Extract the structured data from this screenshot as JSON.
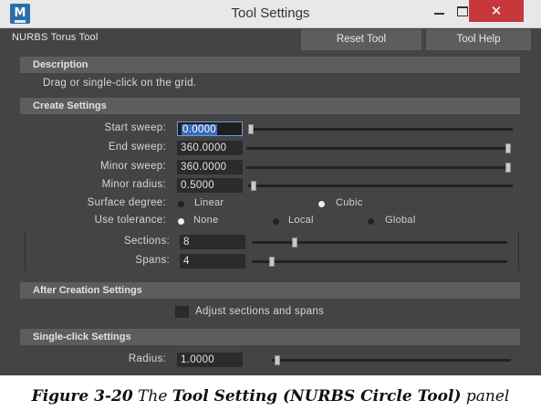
{
  "window": {
    "app_icon_text": "M",
    "title": "Tool Settings",
    "minimize_glyph": "–",
    "maximize_glyph": "□",
    "close_glyph": "✕"
  },
  "toolbar": {
    "tool_name": "NURBS Torus Tool",
    "reset_label": "Reset Tool",
    "help_label": "Tool Help"
  },
  "description": {
    "header": "Description",
    "text": "Drag or single-click on the grid."
  },
  "create_settings": {
    "header": "Create Settings",
    "start_sweep": {
      "label": "Start sweep:",
      "value": "0.0000",
      "slider": 0.0
    },
    "end_sweep": {
      "label": "End sweep:",
      "value": "360.0000",
      "slider": 1.0
    },
    "minor_sweep": {
      "label": "Minor sweep:",
      "value": "360.0000",
      "slider": 1.0
    },
    "minor_radius": {
      "label": "Minor radius:",
      "value": "0.5000",
      "slider": 0.01
    },
    "surface_degree": {
      "label": "Surface degree:",
      "options": [
        "Linear",
        "Cubic"
      ],
      "selected": "Cubic"
    },
    "use_tolerance": {
      "label": "Use tolerance:",
      "options": [
        "None",
        "Local",
        "Global"
      ],
      "selected": "None"
    },
    "sections": {
      "label": "Sections:",
      "value": "8",
      "slider": 0.16
    },
    "spans": {
      "label": "Spans:",
      "value": "4",
      "slider": 0.07
    }
  },
  "after_creation": {
    "header": "After Creation Settings",
    "adjust_label": "Adjust sections and spans",
    "adjust_checked": false
  },
  "single_click": {
    "header": "Single-click Settings",
    "radius": {
      "label": "Radius:",
      "value": "1.0000",
      "slider": 0.01
    }
  },
  "caption": {
    "prefix": "Figure 3-20  The ",
    "bold": "Tool Setting (NURBS Circle Tool)",
    "suffix": " panel"
  }
}
